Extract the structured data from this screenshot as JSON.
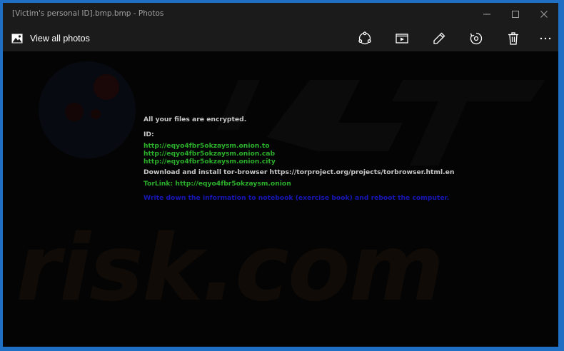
{
  "window": {
    "title": "[Victim's personal ID].bmp.bmp - Photos"
  },
  "toolbar": {
    "view_all_label": "View all photos",
    "icons": [
      "share-icon",
      "slideshow-icon",
      "edit-icon",
      "rotate-icon",
      "delete-icon",
      "more-icon"
    ]
  },
  "note": {
    "line1": "All your files are encrypted.",
    "id_label": "ID:",
    "link1": "http://eqyo4fbr5okzaysm.onion.to",
    "link2": "http://eqyo4fbr5okzaysm.onion.cab",
    "link3": "http://eqyo4fbr5okzaysm.onion.city",
    "download": "Download and install tor-browser https://torproject.org/projects/torbrowser.html.en",
    "torlink": "TorLink: http://eqyo4fbr5okzaysm.onion",
    "instruction": "Write down the information to notebook (exercise book) and reboot the computer."
  },
  "watermark": {
    "text": "risk.com"
  },
  "colors": {
    "accent_border": "#1f6fc5",
    "bar": "#1b1b1b",
    "text_white": "#c8c8c8",
    "text_green": "#2bb02b",
    "text_blue": "#1616b8"
  }
}
